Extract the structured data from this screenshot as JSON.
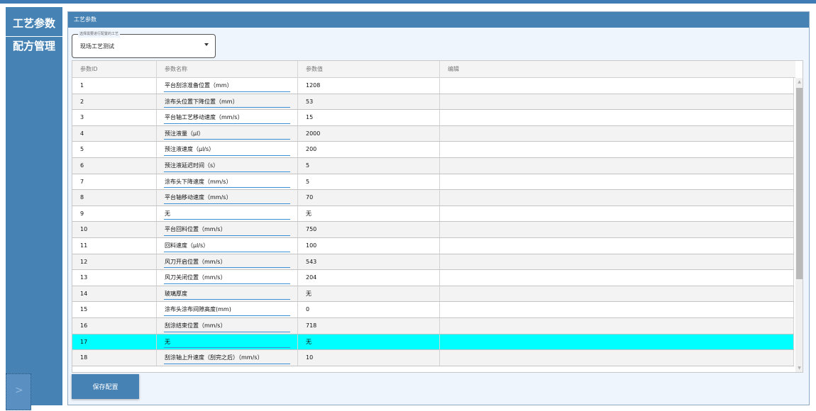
{
  "sidebar": {
    "items": [
      {
        "label": "工艺参数"
      },
      {
        "label": "配方管理"
      }
    ],
    "toggle_icon": "chevron-right-icon"
  },
  "panel": {
    "title": "工艺参数",
    "select": {
      "legend": "选择需要进行配置的工艺",
      "value": "现场工艺测试"
    },
    "save_label": "保存配置"
  },
  "table": {
    "columns": [
      "参数ID",
      "参数名称",
      "参数值",
      "编辑"
    ],
    "rows": [
      {
        "id": "1",
        "name": "平台刮涂准备位置（mm）",
        "value": "1208",
        "edit": ""
      },
      {
        "id": "2",
        "name": "涂布头位置下降位置（mm）",
        "value": "53",
        "edit": ""
      },
      {
        "id": "3",
        "name": "平台轴工艺移动速度（mm/s）",
        "value": "15",
        "edit": ""
      },
      {
        "id": "4",
        "name": "预注液量（μl）",
        "value": "2000",
        "edit": ""
      },
      {
        "id": "5",
        "name": "预注液速度（μl/s）",
        "value": "200",
        "edit": ""
      },
      {
        "id": "6",
        "name": "预注液延迟时间（s）",
        "value": "5",
        "edit": ""
      },
      {
        "id": "7",
        "name": "涂布头下降速度（mm/s）",
        "value": "5",
        "edit": ""
      },
      {
        "id": "8",
        "name": "平台轴移动速度（mm/s）",
        "value": "70",
        "edit": ""
      },
      {
        "id": "9",
        "name": "无",
        "value": "无",
        "edit": ""
      },
      {
        "id": "10",
        "name": "平台回料位置（mm/s）",
        "value": "750",
        "edit": ""
      },
      {
        "id": "11",
        "name": "回料速度（μl/s）",
        "value": "100",
        "edit": ""
      },
      {
        "id": "12",
        "name": "风刀开启位置（mm/s）",
        "value": "543",
        "edit": ""
      },
      {
        "id": "13",
        "name": "风刀关闭位置（mm/s）",
        "value": "204",
        "edit": ""
      },
      {
        "id": "14",
        "name": "玻璃厚度",
        "value": "无",
        "edit": ""
      },
      {
        "id": "15",
        "name": "涂布头涂布间隙高度(mm)",
        "value": "0",
        "edit": ""
      },
      {
        "id": "16",
        "name": "刮涂结束位置（mm/s）",
        "value": "718",
        "edit": ""
      },
      {
        "id": "17",
        "name": "无",
        "value": "无",
        "edit": ""
      },
      {
        "id": "18",
        "name": "刮涂轴上升速度（刮完之后）（mm/s）",
        "value": "10",
        "edit": ""
      }
    ],
    "selected_row": "17"
  },
  "colors": {
    "accent": "#4682b4",
    "selected_row": "#00ffff",
    "underline": "#3a8fd6"
  }
}
